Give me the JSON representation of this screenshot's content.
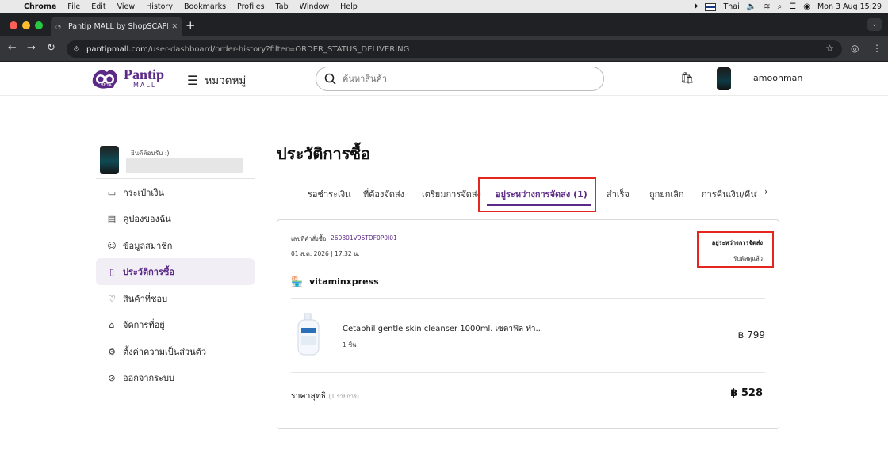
{
  "menubar": {
    "app": "Chrome",
    "items": [
      "File",
      "Edit",
      "View",
      "History",
      "Bookmarks",
      "Profiles",
      "Tab",
      "Window",
      "Help"
    ],
    "input_source": "Thai",
    "clock": "Mon 3 Aug  15:29"
  },
  "browser": {
    "tab_title": "Pantip MALL by ShopSCAPE",
    "url_host": "pantipmall.com",
    "url_path": "/user-dashboard/order-history?filter=ORDER_STATUS_DELIVERING"
  },
  "header": {
    "logo_text": "Pantip",
    "logo_sub": "MALL",
    "logo_badge": "BETA",
    "category_label": "หมวดหมู่",
    "search_placeholder": "ค้นหาสินค้า",
    "username": "lamoonman"
  },
  "sidebar": {
    "welcome": "ยินดีต้อนรับ :)",
    "items": [
      {
        "label": "กระเป๋าเงิน",
        "icon": "wallet-icon"
      },
      {
        "label": "คูปองของฉัน",
        "icon": "coupon-icon"
      },
      {
        "label": "ข้อมูลสมาชิก",
        "icon": "user-icon"
      },
      {
        "label": "ประวัติการซื้อ",
        "icon": "clipboard-icon"
      },
      {
        "label": "สินค้าที่ชอบ",
        "icon": "heart-icon"
      },
      {
        "label": "จัดการที่อยู่",
        "icon": "home-icon"
      },
      {
        "label": "ตั้งค่าความเป็นส่วนตัว",
        "icon": "gear-icon"
      },
      {
        "label": "ออกจากระบบ",
        "icon": "logout-icon"
      }
    ]
  },
  "main": {
    "title": "ประวัติการซื้อ",
    "tabs": [
      "รอชำระเงิน",
      "ที่ต้องจัดส่ง",
      "เตรียมการจัดส่ง",
      "อยู่ระหว่างการจัดส่ง (1)",
      "สำเร็จ",
      "ถูกยกเลิก",
      "การคืนเงิน/คืนสิ"
    ],
    "active_tab_index": 3
  },
  "order": {
    "number_label": "เลขที่คำสั่งซื้อ",
    "number": "260801V96TDF0P0I01",
    "date": "01 ส.ค. 2026 | 17:32 น.",
    "status": "อยู่ระหว่างการจัดส่ง",
    "sub_status": "รับพัสดุแล้ว",
    "shop": "vitaminxpress",
    "product_name": "Cetaphil gentle skin cleanser 1000ml. เซตาฟิล ทำ...",
    "quantity": "1 ชิ้น",
    "price": "฿ 799",
    "total_label": "ราคาสุทธิ",
    "total_count": "(1 รายการ)",
    "total": "฿ 528"
  },
  "colors": {
    "brand": "#5b2a86",
    "highlight": "#e5251e"
  }
}
